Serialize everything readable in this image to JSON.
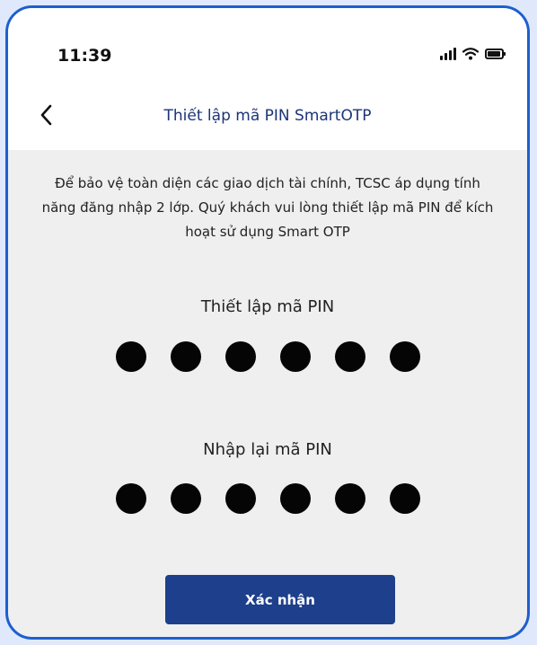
{
  "status_bar": {
    "time": "11:39",
    "icons": [
      "signal-icon",
      "wifi-icon",
      "battery-icon"
    ]
  },
  "nav": {
    "back_icon": "chevron-left-icon",
    "title": "Thiết lập mã PIN SmartOTP"
  },
  "intro_text": "Để bảo vệ toàn diện các giao dịch tài chính, TCSC áp dụng tính năng đăng nhập 2 lớp. Quý khách vui lòng thiết lập mã PIN để kích hoạt sử dụng Smart OTP",
  "pin_setup": {
    "label": "Thiết lập mã PIN",
    "digits_entered": 6
  },
  "pin_confirm": {
    "label": "Nhập lại mã PIN",
    "digits_entered": 6
  },
  "confirm_button": {
    "label": "Xác nhận"
  },
  "colors": {
    "accent": "#1d3f8c",
    "frame": "#1d5fd0",
    "title": "#1c3478",
    "background": "#efefef"
  }
}
